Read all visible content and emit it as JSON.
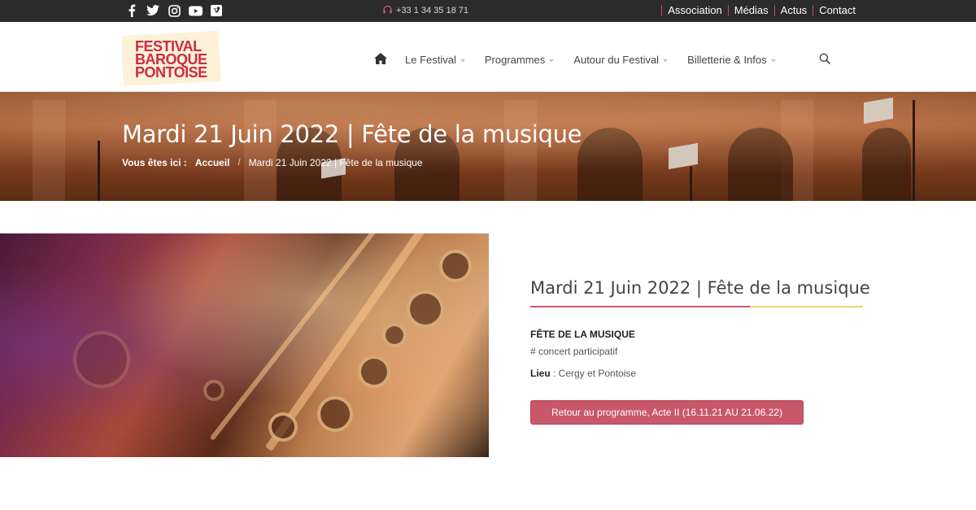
{
  "topbar": {
    "social": [
      {
        "icon": "facebook-icon"
      },
      {
        "icon": "twitter-icon"
      },
      {
        "icon": "instagram-icon"
      },
      {
        "icon": "youtube-icon"
      },
      {
        "icon": "vimeo-icon"
      }
    ],
    "phone": "+33 1 34 35 18 71",
    "links": [
      "Association",
      "Médias",
      "Actus",
      "Contact"
    ]
  },
  "header": {
    "logo": {
      "line1": "FESTIVAL",
      "line2": "BAROQUE",
      "line3": "PONTOISE"
    },
    "nav": [
      "Le Festival",
      "Programmes",
      "Autour du Festival",
      "Billetterie & Infos"
    ]
  },
  "banner": {
    "title": "Mardi 21 Juin 2022 | Fête de la musique",
    "breadcrumb_label": "Vous êtes ici :",
    "breadcrumb_home": "Accueil",
    "breadcrumb_sep": "/",
    "breadcrumb_current": "Mardi 21 Juin 2022 | Fête de la musique"
  },
  "event": {
    "title": "Mardi 21 Juin 2022 | Fête de la musique",
    "heading": "FÊTE DE LA MUSIQUE",
    "tag": "# concert participatif",
    "place_label": "Lieu",
    "place_value": " : Cergy et Pontoise",
    "back_button": "Retour au programme, Acte II (16.11.21 AU 21.06.22)"
  },
  "colors": {
    "accent": "#c9576a",
    "accent_yellow": "#f0d36a",
    "topbar_bg": "#2b2b2b",
    "logo_red": "#cc2a4a"
  }
}
